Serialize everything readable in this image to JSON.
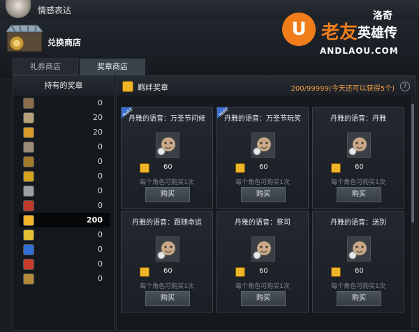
{
  "topbar": {
    "title": "情感表达"
  },
  "shop": {
    "title": "兑换商店"
  },
  "watermark": {
    "letter": "U",
    "brand": "老友",
    "game_top": "洛奇",
    "game": "英雄传",
    "url": "ANDLAOU.COM"
  },
  "tabs": [
    {
      "label": "礼券商店",
      "active": false
    },
    {
      "label": "奖章商店",
      "active": true
    }
  ],
  "left": {
    "title": "持有的奖章",
    "medals": [
      {
        "icon": "bronze-shield-medal-icon",
        "color": "#8a6b4a",
        "count": "0"
      },
      {
        "icon": "silver-crest-medal-icon",
        "color": "#b8a07a",
        "count": "20"
      },
      {
        "icon": "gold-sun-medal-icon",
        "color": "#d99a2a",
        "count": "20"
      },
      {
        "icon": "stone-badge-medal-icon",
        "color": "#9a8a76",
        "count": "0"
      },
      {
        "icon": "dark-wing-medal-icon",
        "color": "#a2782a",
        "count": "0"
      },
      {
        "icon": "gold-wreath-medal-icon",
        "color": "#d6a320",
        "count": "0"
      },
      {
        "icon": "sword-medal-icon",
        "color": "#9aa0a6",
        "count": "0"
      },
      {
        "icon": "red-gem-medal-icon",
        "color": "#c0392b",
        "count": "0"
      },
      {
        "icon": "smile-medal-icon",
        "color": "#f0b428",
        "count": "200",
        "selected": true
      },
      {
        "icon": "yellow-star-medal-icon",
        "color": "#e6c033",
        "count": "0"
      },
      {
        "icon": "blue-shield-medal-icon",
        "color": "#2f6fd6",
        "count": "0"
      },
      {
        "icon": "red-orb-medal-icon",
        "color": "#c83a2a",
        "count": "0"
      },
      {
        "icon": "dark-skull-medal-icon",
        "color": "#b08a3a",
        "count": "0"
      }
    ]
  },
  "right": {
    "title": "羁绊奖章",
    "count_text": "200/99999(今天还可以获得5个)",
    "help": "?",
    "cards": [
      {
        "title": "丹雅的语音：万圣节问候",
        "rare": true,
        "rare_text": "RARE",
        "price": "60",
        "limit": "每个角色可购买1次",
        "buy": "购买"
      },
      {
        "title": "丹雅的语音：万圣节玩笑",
        "rare": true,
        "rare_text": "RARE",
        "price": "60",
        "limit": "每个角色可购买1次",
        "buy": "购买"
      },
      {
        "title": "丹雅的语音：丹雅",
        "rare": false,
        "rare_text": "",
        "price": "60",
        "limit": "每个角色可购买1次",
        "buy": "购买"
      },
      {
        "title": "丹雅的语音：跟随命运",
        "rare": false,
        "rare_text": "",
        "price": "60",
        "limit": "每个角色可购买1次",
        "buy": "购买"
      },
      {
        "title": "丹雅的语音：祭司",
        "rare": false,
        "rare_text": "",
        "price": "60",
        "limit": "每个角色可购买1次",
        "buy": "购买"
      },
      {
        "title": "丹雅的语音：送别",
        "rare": false,
        "rare_text": "",
        "price": "60",
        "limit": "每个角色可购买1次",
        "buy": "购买"
      }
    ]
  }
}
